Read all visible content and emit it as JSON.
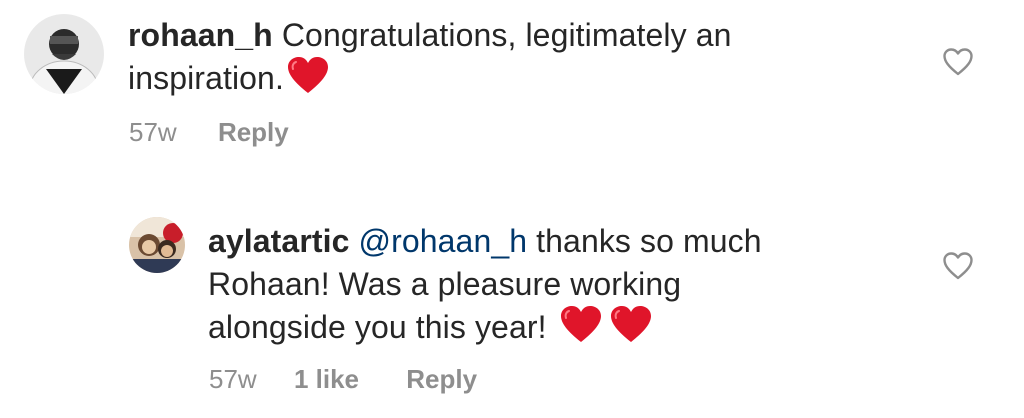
{
  "comments": [
    {
      "username": "rohaan_h",
      "text_line1": "Congratulations, legitimately an",
      "text_line2": "inspiration.",
      "emoji": "heart-emoji",
      "time": "57w",
      "reply_label": "Reply"
    },
    {
      "username": "aylatartic",
      "mention": "@rohaan_h",
      "text_line1": "thanks so much",
      "text_line2": "Rohaan! Was a pleasure working",
      "text_line3": "alongside you this year!",
      "emoji": "heart-emoji",
      "time": "57w",
      "likes_label": "1 like",
      "reply_label": "Reply"
    }
  ],
  "colors": {
    "text": "#262626",
    "meta": "#8e8e8e",
    "mention": "#00376b",
    "heart": "#e0152a"
  },
  "icons": {
    "like": "heart-outline-icon"
  }
}
